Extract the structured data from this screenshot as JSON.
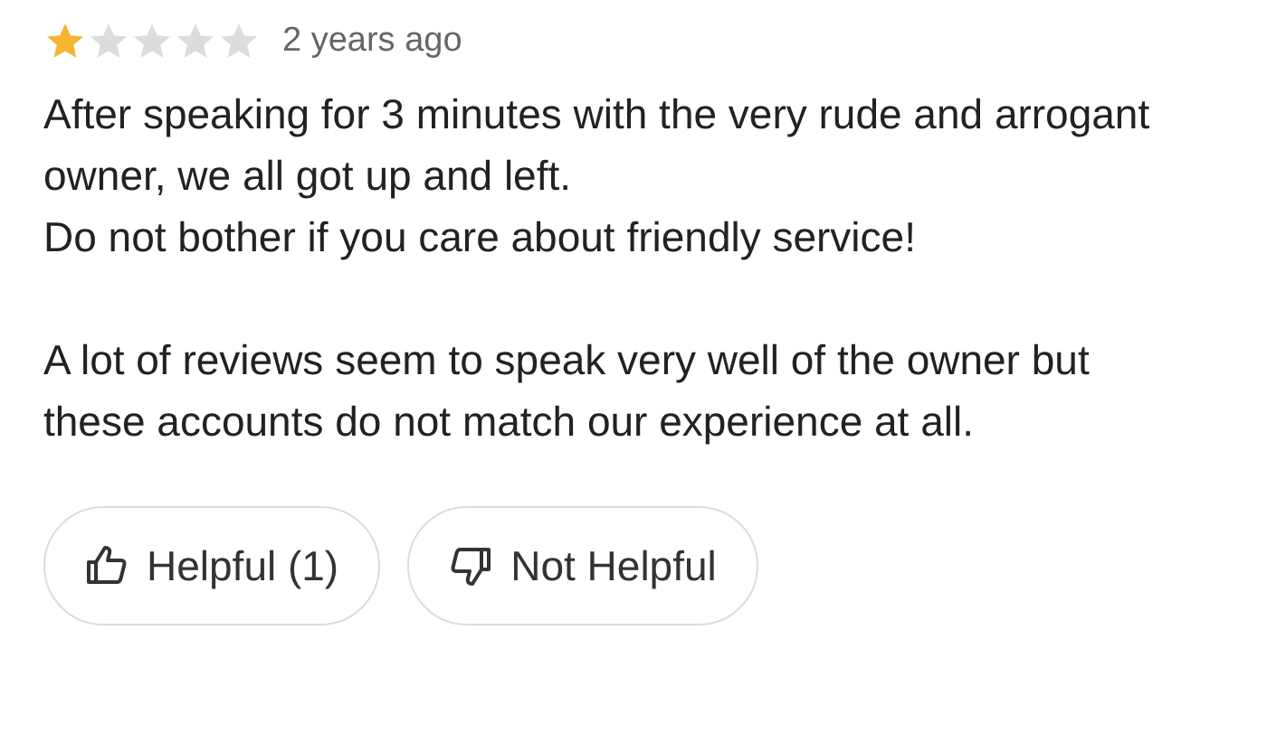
{
  "review": {
    "stars": 1,
    "time": "2 years ago",
    "paragraphs": [
      "After speaking for 3 minutes with the very rude and arrogant owner, we all got up and left.\nDo not bother if you care about friendly service!",
      "A lot of reviews seem to speak very well of the owner but these accounts do not match our experience at all."
    ]
  },
  "buttons": [
    {
      "kind": "helpful",
      "label": "Helpful (1)"
    },
    {
      "kind": "not_helpful",
      "label": "Not Helpful"
    }
  ]
}
